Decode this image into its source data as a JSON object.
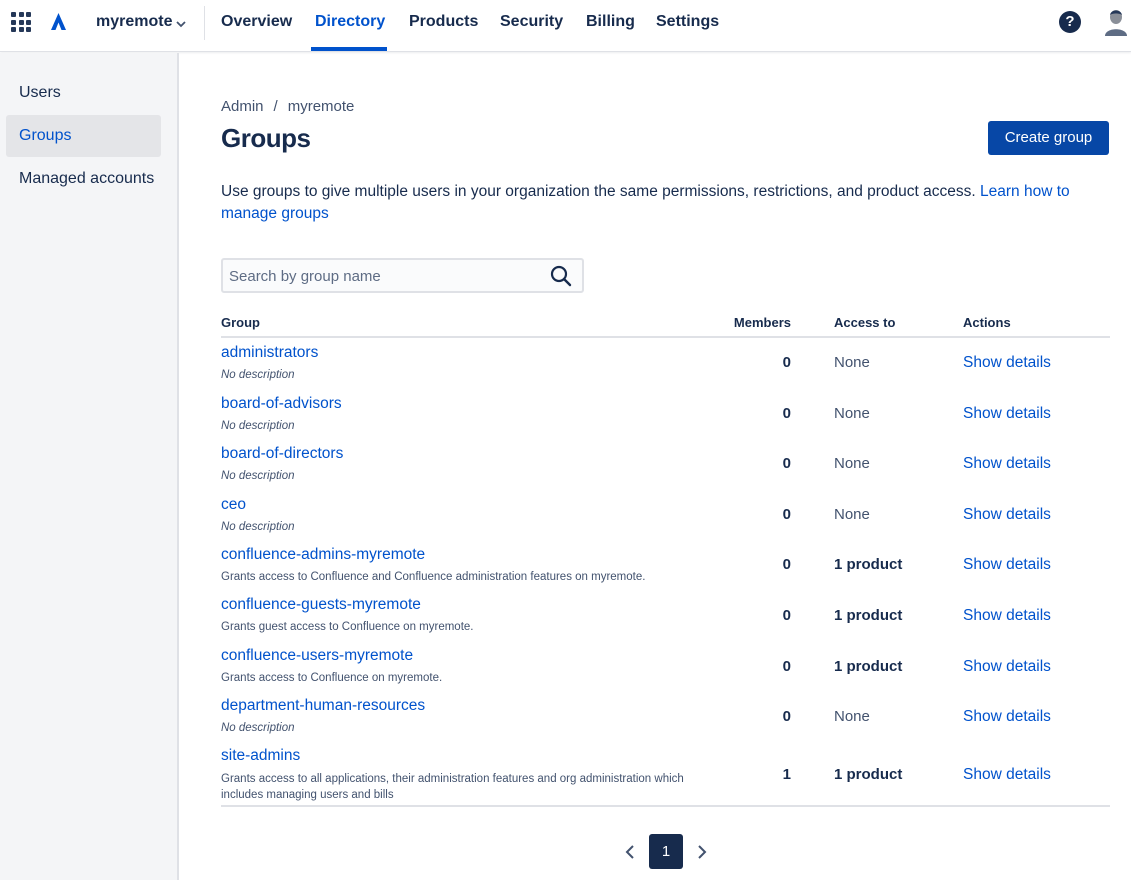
{
  "header": {
    "org_name": "myremote",
    "nav": [
      "Overview",
      "Directory",
      "Products",
      "Security",
      "Billing",
      "Settings"
    ],
    "active_nav": "Directory",
    "help_label": "?"
  },
  "sidebar": {
    "items": [
      "Users",
      "Groups",
      "Managed accounts"
    ],
    "active": "Groups"
  },
  "main": {
    "breadcrumb": {
      "root": "Admin",
      "separator": "/",
      "current": "myremote"
    },
    "title": "Groups",
    "create_button": "Create group",
    "description": "Use groups to give multiple users in your organization the same permissions, restrictions, and product access.",
    "learn_link": "Learn how to manage groups",
    "search_placeholder": "Search by group name"
  },
  "table": {
    "columns": {
      "group": "Group",
      "members": "Members",
      "access": "Access to",
      "actions": "Actions"
    },
    "rows": [
      {
        "name": "administrators",
        "description": "No description",
        "members": "0",
        "access": "None",
        "action": "Show details"
      },
      {
        "name": "board-of-advisors",
        "description": "No description",
        "members": "0",
        "access": "None",
        "action": "Show details"
      },
      {
        "name": "board-of-directors",
        "description": "No description",
        "members": "0",
        "access": "None",
        "action": "Show details"
      },
      {
        "name": "ceo",
        "description": "No description",
        "members": "0",
        "access": "None",
        "action": "Show details"
      },
      {
        "name": "confluence-admins-myremote",
        "description": "Grants access to Confluence and Confluence administration features on myremote.",
        "members": "0",
        "access": "1 product",
        "action": "Show details"
      },
      {
        "name": "confluence-guests-myremote",
        "description": "Grants guest access to Confluence on myremote.",
        "members": "0",
        "access": "1 product",
        "action": "Show details"
      },
      {
        "name": "confluence-users-myremote",
        "description": "Grants access to Confluence on myremote.",
        "members": "0",
        "access": "1 product",
        "action": "Show details"
      },
      {
        "name": "department-human-resources",
        "description": "No description",
        "members": "0",
        "access": "None",
        "action": "Show details"
      },
      {
        "name": "site-admins",
        "description": "Grants access to all applications, their administration features and org administration which includes managing users and bills",
        "members": "1",
        "access": "1 product",
        "action": "Show details"
      }
    ]
  },
  "pagination": {
    "current_page": "1"
  },
  "colors": {
    "brand": "#0052cc",
    "button": "#0747a6",
    "text": "#172b4d",
    "sidebar_bg": "#f4f5f7"
  }
}
